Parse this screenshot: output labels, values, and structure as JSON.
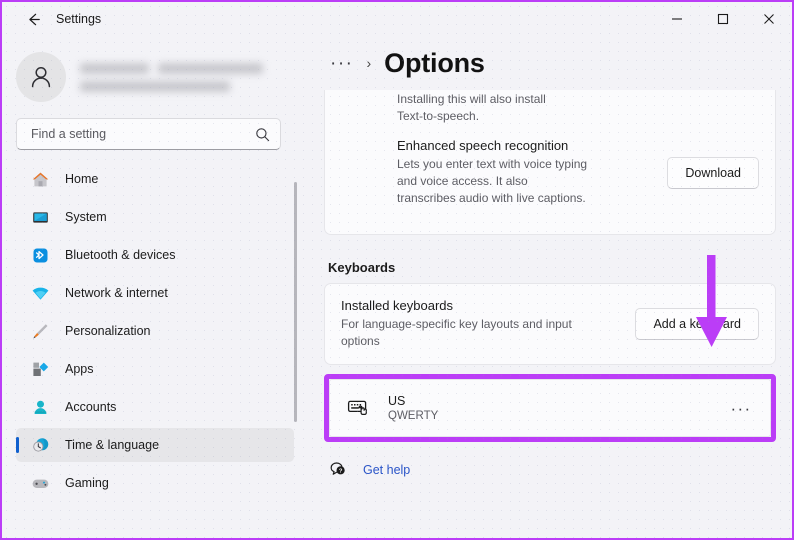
{
  "window": {
    "title": "Settings",
    "back_icon": "back-arrow-icon",
    "controls": [
      {
        "name": "minimize",
        "glyph": "─"
      },
      {
        "name": "maximize",
        "glyph": "□"
      },
      {
        "name": "close",
        "glyph": "✕"
      }
    ]
  },
  "profile": {
    "avatar_icon": "person-icon",
    "name_redacted": true,
    "email_redacted": true
  },
  "search": {
    "placeholder": "Find a setting",
    "value": "",
    "icon": "search-icon"
  },
  "sidebar": {
    "items": [
      {
        "label": "Home",
        "icon": "home-icon",
        "selected": false
      },
      {
        "label": "System",
        "icon": "system-icon",
        "selected": false
      },
      {
        "label": "Bluetooth & devices",
        "icon": "bluetooth-icon",
        "selected": false
      },
      {
        "label": "Network & internet",
        "icon": "wifi-icon",
        "selected": false
      },
      {
        "label": "Personalization",
        "icon": "paintbrush-icon",
        "selected": false
      },
      {
        "label": "Apps",
        "icon": "apps-icon",
        "selected": false
      },
      {
        "label": "Accounts",
        "icon": "accounts-icon",
        "selected": false
      },
      {
        "label": "Time & language",
        "icon": "clock-globe-icon",
        "selected": true
      },
      {
        "label": "Gaming",
        "icon": "gamepad-icon",
        "selected": false
      }
    ]
  },
  "breadcrumb": {
    "overflow": "···",
    "separator": "›",
    "title": "Options"
  },
  "main": {
    "partial_text": "Installing this will also install Text-to-speech.",
    "speech_card": {
      "title": "Enhanced speech recognition",
      "subtitle": "Lets you enter text with voice typing and voice access. It also transcribes audio with live captions.",
      "button": "Download"
    },
    "keyboards_section": {
      "heading": "Keyboards",
      "installed": {
        "title": "Installed keyboards",
        "subtitle": "For language-specific key layouts and input options",
        "button": "Add a keyboard"
      },
      "layout": {
        "name": "US",
        "type": "QWERTY",
        "icon": "keyboard-cursor-icon",
        "more_glyph": "···",
        "highlighted": true
      }
    },
    "get_help": {
      "label": "Get help",
      "icon": "help-bubble-icon"
    }
  },
  "annotations": {
    "arrow_color": "#bb3df7",
    "highlight_color": "#bb3df7",
    "arrow_target": "Add a keyboard",
    "highlight_target": "US QWERTY keyboard row"
  },
  "colors": {
    "accent_blue": "#0f5fce",
    "link_blue": "#2a55c8",
    "page_bg": "#f3f3f7",
    "card_bg": "#fbfbfd",
    "annotation_purple": "#bb3df7"
  }
}
